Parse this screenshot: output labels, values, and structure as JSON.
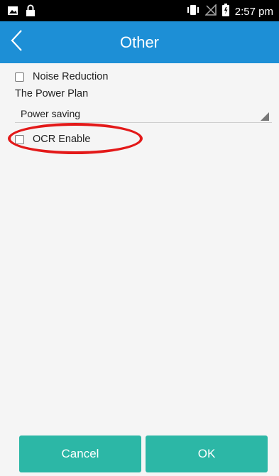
{
  "status_bar": {
    "time": "2:57 pm",
    "left_icons": [
      "image-icon",
      "lock-icon"
    ],
    "right_icons": [
      "vibrate-icon",
      "no-signal-icon",
      "battery-icon"
    ]
  },
  "app_bar": {
    "title": "Other",
    "back_icon": "chevron-left-icon",
    "color": "#1d8fd6"
  },
  "settings": {
    "noise_reduction": {
      "label": "Noise Reduction",
      "checked": false
    },
    "power_plan": {
      "label": "The Power Plan",
      "selected": "Power saving"
    },
    "ocr_enable": {
      "label": "OCR Enable",
      "checked": false,
      "highlighted": true
    }
  },
  "buttons": {
    "cancel": "Cancel",
    "ok": "OK",
    "color": "#2cb7a6"
  }
}
